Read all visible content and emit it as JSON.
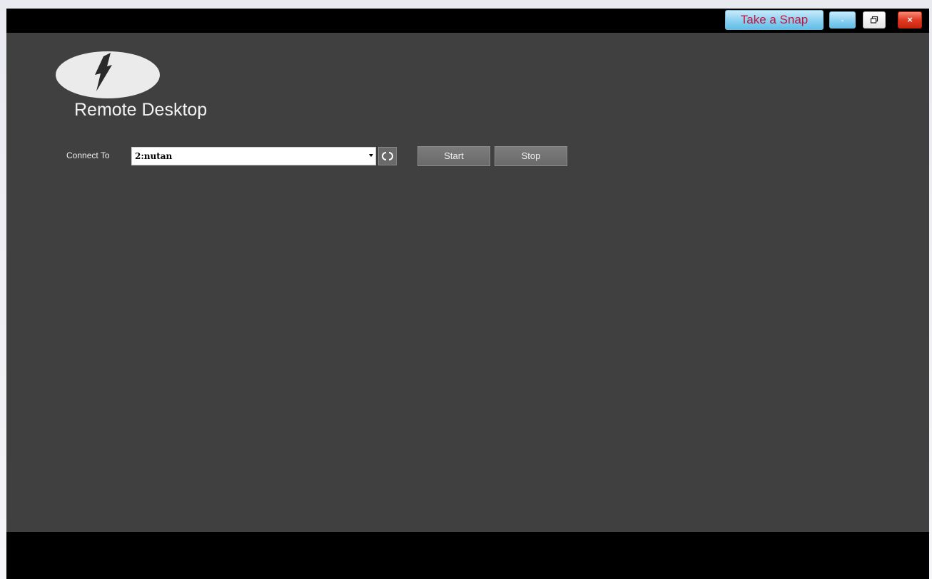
{
  "window": {
    "snap_label": "Take a Snap",
    "minimize_label": "-",
    "close_label": "×"
  },
  "header": {
    "title": "Remote Desktop"
  },
  "connect": {
    "label": "Connect To",
    "selected_value": "2:nutan"
  },
  "actions": {
    "start_label": "Start",
    "stop_label": "Stop"
  },
  "icons": {
    "logo": "lightning-bolt-icon",
    "restore": "restore-icon",
    "refresh": "refresh-icon",
    "dropdown": "chevron-down-icon"
  },
  "colors": {
    "app_background": "#404040",
    "bars": "#000000",
    "snap_text": "#c8103c",
    "close_button": "#e23a22"
  }
}
